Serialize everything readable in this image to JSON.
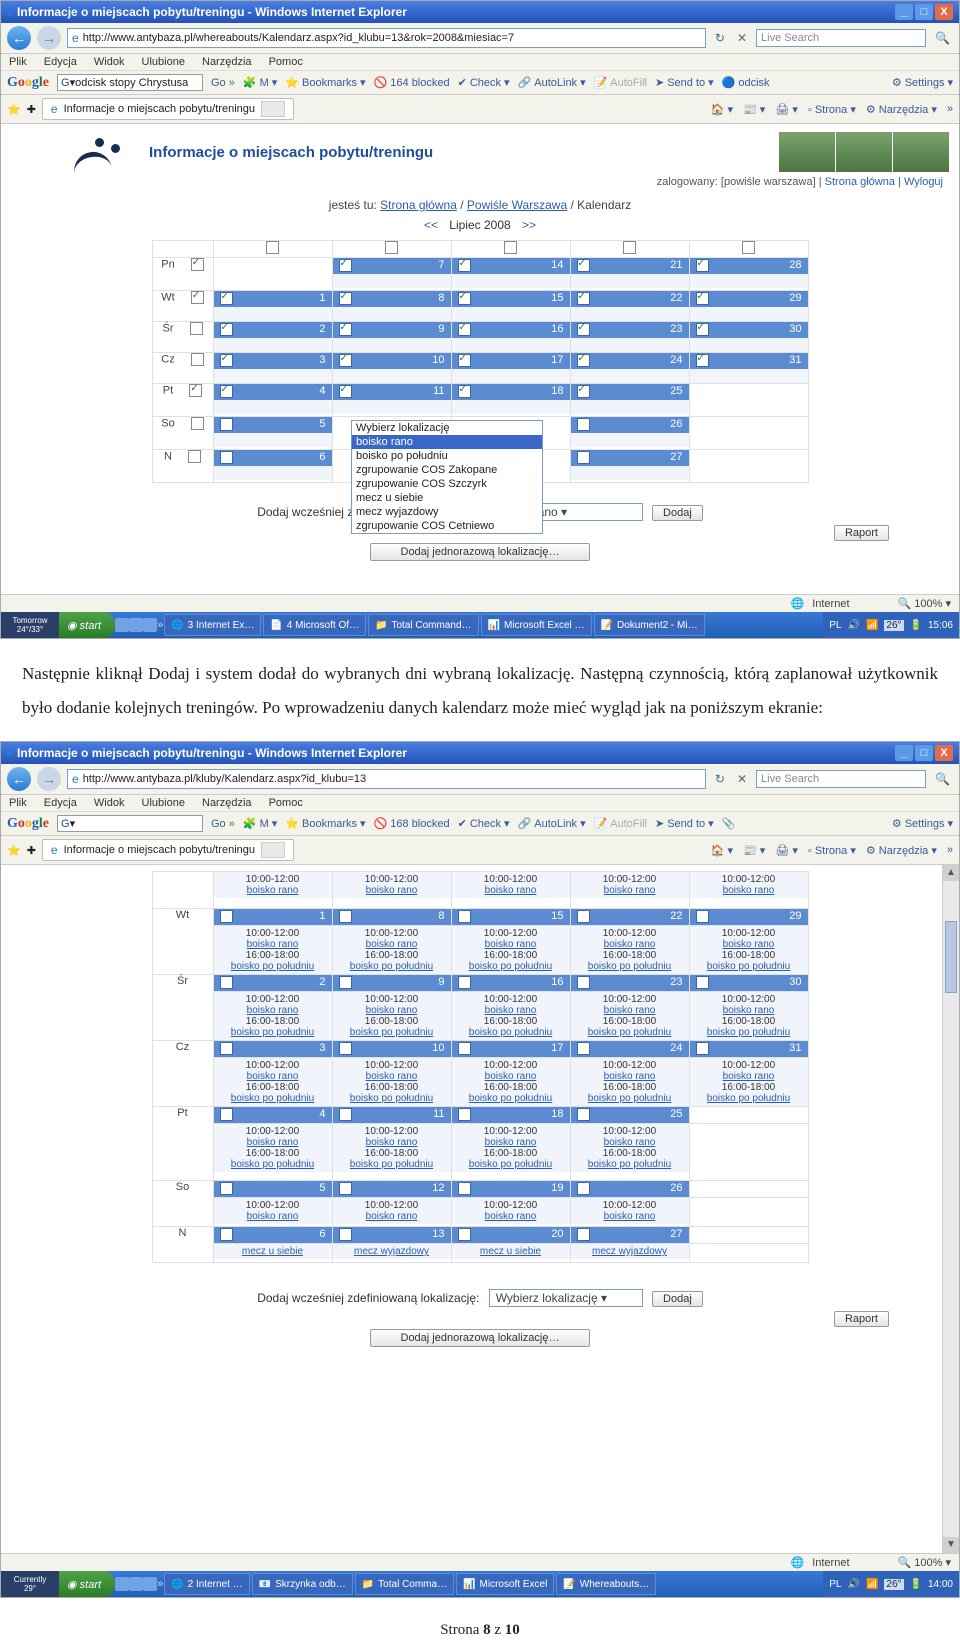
{
  "shot1": {
    "title": "Informacje o miejscach pobytu/treningu - Windows Internet Explorer",
    "url": "http://www.antybaza.pl/whereabouts/Kalendarz.aspx?id_klubu=13&rok=2008&miesiac=7",
    "search_ph": "Live Search",
    "menu": [
      "Plik",
      "Edycja",
      "Widok",
      "Ulubione",
      "Narzędzia",
      "Pomoc"
    ],
    "gbar": {
      "input": "odcisk stopy Chrystusa",
      "go": "Go",
      "bookmarks": "Bookmarks",
      "blocked": "164 blocked",
      "check": "Check",
      "autolink": "AutoLink",
      "autofill": "AutoFill",
      "sendto": "Send to",
      "odcisk": "odcisk",
      "settings": "Settings"
    },
    "tab": "Informacje o miejscach pobytu/treningu",
    "toolright": {
      "strona": "Strona",
      "narz": "Narzędzia"
    },
    "banner": "Informacje o miejscach pobytu/treningu",
    "login": {
      "pre": "zalogowany: [",
      "user": "powiśle warszawa",
      "post": "] | ",
      "home": "Strona główna",
      "logout": "Wyloguj"
    },
    "bc": {
      "pre": "jesteś tu: ",
      "home": "Strona główna",
      "club": "Powiśle Warszawa",
      "cur": "Kalendarz"
    },
    "month": {
      "prev": "<<",
      "label": "Lipiec 2008",
      "next": ">>"
    },
    "days": [
      "Pn",
      "Wt",
      "Śr",
      "Cz",
      "Pt",
      "So",
      "N"
    ],
    "daychk": [
      true,
      true,
      false,
      false,
      true,
      false,
      false
    ],
    "grid": [
      [
        null,
        "7",
        "14",
        "21",
        "28"
      ],
      [
        "1",
        "8",
        "15",
        "22",
        "29"
      ],
      [
        "2",
        "9",
        "16",
        "23",
        "30"
      ],
      [
        "3",
        "10",
        "17",
        "24",
        "31"
      ],
      [
        "4",
        "11",
        "18",
        "25",
        null
      ],
      [
        "5",
        null,
        null,
        "26",
        null
      ],
      [
        "6",
        null,
        null,
        "27",
        null
      ]
    ],
    "dd": [
      "Wybierz lokalizację",
      "boisko rano",
      "boisko po południu",
      "zgrupowanie COS Zakopane",
      "zgrupowanie COS Szczyrk",
      "mecz u siebie",
      "mecz wyjazdowy",
      "zgrupowanie COS Cetniewo"
    ],
    "addlabel": "Dodaj wcześniej zdefiniowaną lokalizację:",
    "addsel": "boisko rano",
    "addbtn": "Dodaj",
    "raport": "Raport",
    "add2": "Dodaj jednorazową lokalizację…",
    "status": {
      "net": "Internet",
      "zoom": "100%"
    },
    "task": {
      "weather": {
        "l1": "Tomorrow",
        "l2": "24°/33°"
      },
      "items": [
        "3 Internet Ex…",
        "4 Microsoft Of…",
        "Total Command…",
        "Microsoft Excel …",
        "Dokument2 - Mi…"
      ],
      "tray": {
        "lang": "PL",
        "time": "15:06",
        "temp": "26°"
      }
    }
  },
  "para1": "Następnie kliknął Dodaj i system dodał do wybranych dni wybraną lokalizację. Następną czynnością, którą zaplanował użytkownik było dodanie kolejnych treningów. Po wprowadzeniu danych kalendarz może mieć wygląd jak na poniższym ekranie:",
  "shot2": {
    "title": "Informacje o miejscach pobytu/treningu - Windows Internet Explorer",
    "url": "http://www.antybaza.pl/kluby/Kalendarz.aspx?id_klubu=13",
    "search_ph": "Live Search",
    "gbar": {
      "input": "",
      "go": "Go",
      "bookmarks": "Bookmarks",
      "blocked": "168 blocked",
      "check": "Check",
      "autolink": "AutoLink",
      "autofill": "AutoFill",
      "sendto": "Send to",
      "settings": "Settings"
    },
    "tab": "Informacje o miejscach pobytu/treningu",
    "days": [
      "Wt",
      "Śr",
      "Cz",
      "Pt",
      "So",
      "N"
    ],
    "t1": "10:00-12:00",
    "loc1": "boisko rano",
    "t2": "16:00-18:00",
    "loc2": "boisko po południu",
    "mecz1": "mecz u siebie",
    "mecz2": "mecz wyjazdowy",
    "nums": {
      "row0": [
        "",
        "",
        "",
        "",
        ""
      ],
      "row1": [
        "1",
        "8",
        "15",
        "22",
        "29"
      ],
      "row2": [
        "2",
        "9",
        "16",
        "23",
        "30"
      ],
      "row3": [
        "3",
        "10",
        "17",
        "24",
        "31"
      ],
      "row4": [
        "4",
        "11",
        "18",
        "25",
        ""
      ],
      "row5": [
        "5",
        "12",
        "19",
        "26",
        ""
      ],
      "row6": [
        "6",
        "13",
        "20",
        "27",
        ""
      ]
    },
    "addlabel": "Dodaj wcześniej zdefiniowaną lokalizację:",
    "addsel": "Wybierz lokalizację",
    "addbtn": "Dodaj",
    "raport": "Raport",
    "add2": "Dodaj jednorazową lokalizację…",
    "status": {
      "net": "Internet",
      "zoom": "100%"
    },
    "task": {
      "weather": {
        "l1": "Currently",
        "l2": "29°"
      },
      "items": [
        "2 Internet …",
        "Skrzynka odb…",
        "Total Comma…",
        "Microsoft Excel",
        "Whereabouts…"
      ],
      "tray": {
        "lang": "PL",
        "time": "14:00",
        "temp": "26°"
      }
    }
  },
  "footer": "Strona 8 z 10"
}
